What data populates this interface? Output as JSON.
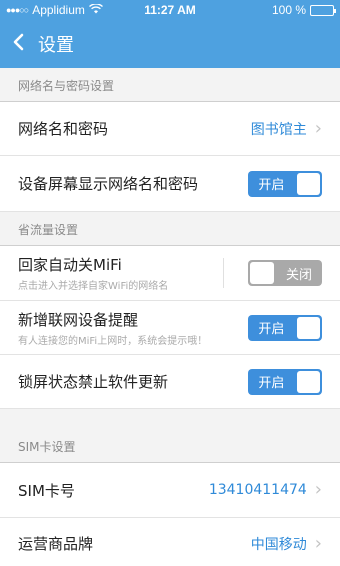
{
  "status_bar": {
    "carrier": "Applidium",
    "time": "11:27 AM",
    "battery": "100 %"
  },
  "nav": {
    "title": "设置"
  },
  "sections": {
    "network": {
      "header": "网络名与密码设置",
      "name_password": {
        "label": "网络名和密码",
        "value": "图书馆主"
      },
      "show_on_screen": {
        "label": "设备屏幕显示网络名和密码",
        "toggle": "开启"
      }
    },
    "traffic": {
      "header": "省流量设置",
      "auto_close": {
        "label": "回家自动关MiFi",
        "sub": "点击进入并选择自家WiFi的网络名",
        "toggle": "关闭"
      },
      "new_device": {
        "label": "新增联网设备提醒",
        "sub": "有人连接您的MiFi上网时，系统会提示哦！",
        "toggle": "开启"
      },
      "lock_update": {
        "label": "锁屏状态禁止软件更新",
        "toggle": "开启"
      }
    },
    "sim": {
      "header": "SIM卡设置",
      "sim_number": {
        "label": "SIM卡号",
        "value": "13410411474"
      },
      "carrier_brand": {
        "label": "运营商品牌",
        "value": "中国移动"
      }
    }
  },
  "icons": {
    "back": "back-chevron-icon",
    "chevron": "chevron-right-icon",
    "wifi": "wifi-icon",
    "battery": "battery-icon"
  },
  "colors": {
    "accent": "#4ea1e0",
    "toggle_on": "#3e8fdc",
    "toggle_off": "#a9a9a9",
    "value_blue": "#2f8ad8"
  }
}
